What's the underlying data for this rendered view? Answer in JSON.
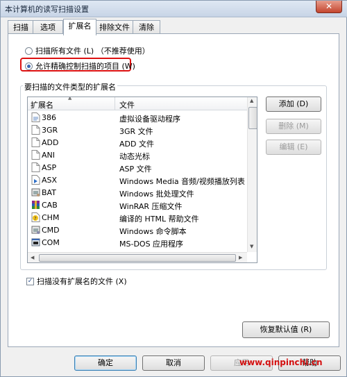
{
  "window": {
    "title": "本计算机的读写扫描设置",
    "close_glyph": "✕"
  },
  "tabs": [
    "扫描",
    "选项",
    "扩展名",
    "排除文件",
    "清除"
  ],
  "radios": {
    "all_files": "扫描所有文件 (L) （不推荐使用）",
    "allow_control": "允许精确控制扫描的项目 (W)"
  },
  "group": {
    "label": "要扫描的文件类型的扩展名"
  },
  "list": {
    "col_ext": "扩展名",
    "col_file": "文件",
    "rows": [
      {
        "ext": "386",
        "desc": "虚拟设备驱动程序",
        "icon": "document-icon"
      },
      {
        "ext": "3GR",
        "desc": "3GR 文件",
        "icon": "blank-file-icon"
      },
      {
        "ext": "ADD",
        "desc": "ADD 文件",
        "icon": "blank-file-icon"
      },
      {
        "ext": "ANI",
        "desc": "动态光标",
        "icon": "blank-file-icon"
      },
      {
        "ext": "ASP",
        "desc": "ASP 文件",
        "icon": "blank-file-icon"
      },
      {
        "ext": "ASX",
        "desc": "Windows Media 音频/视频播放列表",
        "icon": "media-playlist-icon"
      },
      {
        "ext": "BAT",
        "desc": "Windows 批处理文件",
        "icon": "batch-file-icon"
      },
      {
        "ext": "CAB",
        "desc": "WinRAR 压缩文件",
        "icon": "winrar-archive-icon"
      },
      {
        "ext": "CHM",
        "desc": "编译的 HTML 帮助文件",
        "icon": "help-file-icon"
      },
      {
        "ext": "CMD",
        "desc": "Windows 命令脚本",
        "icon": "command-script-icon"
      },
      {
        "ext": "COM",
        "desc": "MS-DOS 应用程序",
        "icon": "dos-app-icon"
      }
    ]
  },
  "side_buttons": {
    "add": "添加 (D)",
    "remove": "删除 (M)",
    "edit": "编辑 (E)"
  },
  "checkbox": {
    "label": "扫描没有扩展名的文件 (X)"
  },
  "restore_button": "恢复默认值 (R)",
  "footer": {
    "ok": "确定",
    "cancel": "取消",
    "apply": "应用",
    "help": "帮助"
  },
  "watermark": "www.qinpinchi.cn",
  "colors": {
    "highlight": "#dd1111",
    "watermark": "#d41010"
  }
}
